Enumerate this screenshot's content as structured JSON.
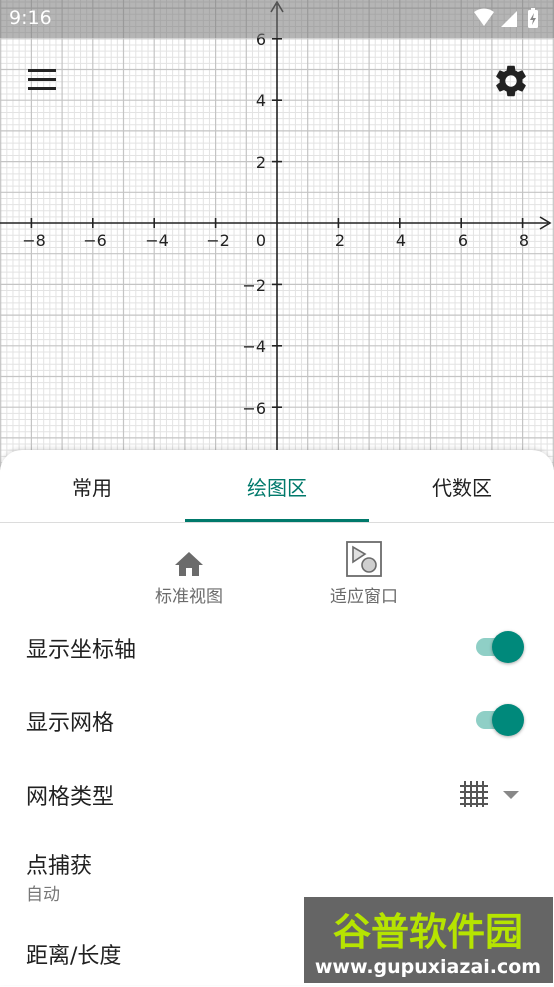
{
  "status_bar": {
    "time": "9:16"
  },
  "graph": {
    "x_ticks": [
      "−8",
      "−6",
      "−4",
      "−2",
      "2",
      "4",
      "6",
      "8"
    ],
    "y_ticks": [
      "6",
      "4",
      "2",
      "−2",
      "−4",
      "−6"
    ],
    "origin_label": "0"
  },
  "tabs": [
    {
      "label": "常用"
    },
    {
      "label": "绘图区"
    },
    {
      "label": "代数区"
    }
  ],
  "active_tab": "绘图区",
  "view_buttons": {
    "standard_view": "标准视图",
    "fit_window": "适应窗口"
  },
  "settings": {
    "show_axes": {
      "label": "显示坐标轴",
      "on": true
    },
    "show_grid": {
      "label": "显示网格",
      "on": true
    },
    "grid_type": {
      "label": "网格类型"
    },
    "point_capturing": {
      "label": "点捕获",
      "value": "自动"
    },
    "distance": {
      "label": "距离/长度"
    }
  },
  "watermark": {
    "title": "谷普软件园",
    "url": "www.gupuxiazai.com"
  },
  "colors": {
    "accent": "#00796b",
    "switch_thumb": "#00897b",
    "switch_track": "#8fcfc6",
    "watermark_green": "#b6e400"
  },
  "icons": {
    "menu": "menu-icon",
    "settings": "gear-icon",
    "standard_view": "home-icon",
    "fit_window": "fit-window-icon",
    "grid_type": "grid-icon"
  }
}
